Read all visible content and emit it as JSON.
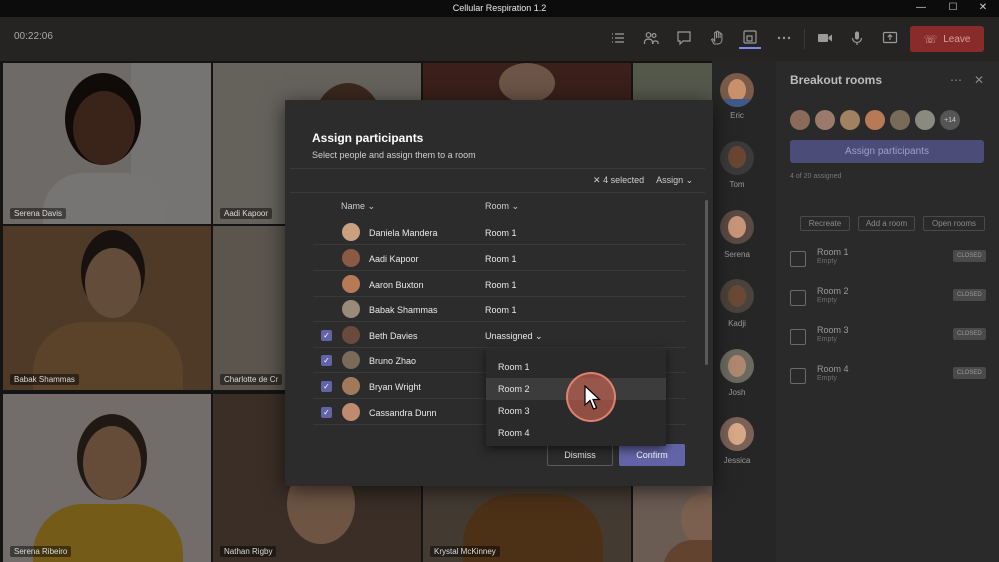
{
  "window": {
    "title": "Cellular Respiration 1.2"
  },
  "toolbar": {
    "timer": "00:22:06",
    "leave_label": "Leave",
    "icons": [
      "list-icon",
      "people-icon",
      "chat-icon",
      "raise-hand-icon",
      "breakout-rooms-icon",
      "more-icon",
      "camera-icon",
      "mic-icon",
      "share-icon"
    ]
  },
  "grid": {
    "tiles": [
      "Serena Davis",
      "Aadi Kapoor",
      "Babak Shammas",
      "Charlotte de Cr",
      "Serena Ribeiro",
      "Nathan Rigby",
      "Krystal McKinney"
    ]
  },
  "strip": {
    "participants": [
      "Eric",
      "Tom",
      "Serena",
      "Kadji",
      "Josh",
      "Jessica"
    ]
  },
  "panel": {
    "title": "Breakout rooms",
    "avatar_overflow": "+14",
    "assign_label": "Assign participants",
    "assigned_status": "4 of 20 assigned",
    "recreate_label": "Recreate",
    "add_room_label": "Add a room",
    "open_rooms_label": "Open rooms",
    "rooms": [
      {
        "name": "Room 1",
        "sub": "Empty",
        "badge": "CLOSED"
      },
      {
        "name": "Room 2",
        "sub": "Empty",
        "badge": "CLOSED"
      },
      {
        "name": "Room 3",
        "sub": "Empty",
        "badge": "CLOSED"
      },
      {
        "name": "Room 4",
        "sub": "Empty",
        "badge": "CLOSED"
      }
    ]
  },
  "dialog": {
    "title": "Assign participants",
    "subtitle": "Select people and assign them to a room",
    "selected_label": "4 selected",
    "assign_label": "Assign",
    "col_name": "Name",
    "col_room": "Room",
    "rows": [
      {
        "name": "Daniela Mandera",
        "room": "Room 1",
        "checked": false
      },
      {
        "name": "Aadi Kapoor",
        "room": "Room 1",
        "checked": false
      },
      {
        "name": "Aaron Buxton",
        "room": "Room 1",
        "checked": false
      },
      {
        "name": "Babak Shammas",
        "room": "Room 1",
        "checked": false
      },
      {
        "name": "Beth Davies",
        "room": "Unassigned",
        "checked": true
      },
      {
        "name": "Bruno Zhao",
        "room": "",
        "checked": true
      },
      {
        "name": "Bryan Wright",
        "room": "",
        "checked": true
      },
      {
        "name": "Cassandra Dunn",
        "room": "",
        "checked": true
      }
    ],
    "dismiss_label": "Dismiss",
    "confirm_label": "Confirm",
    "dropdown_options": [
      "Room 1",
      "Room 2",
      "Room 3",
      "Room 4"
    ],
    "dropdown_highlight": "Room 2"
  },
  "colors": {
    "accent": "#6264a7",
    "leave": "#8a2b2b"
  }
}
